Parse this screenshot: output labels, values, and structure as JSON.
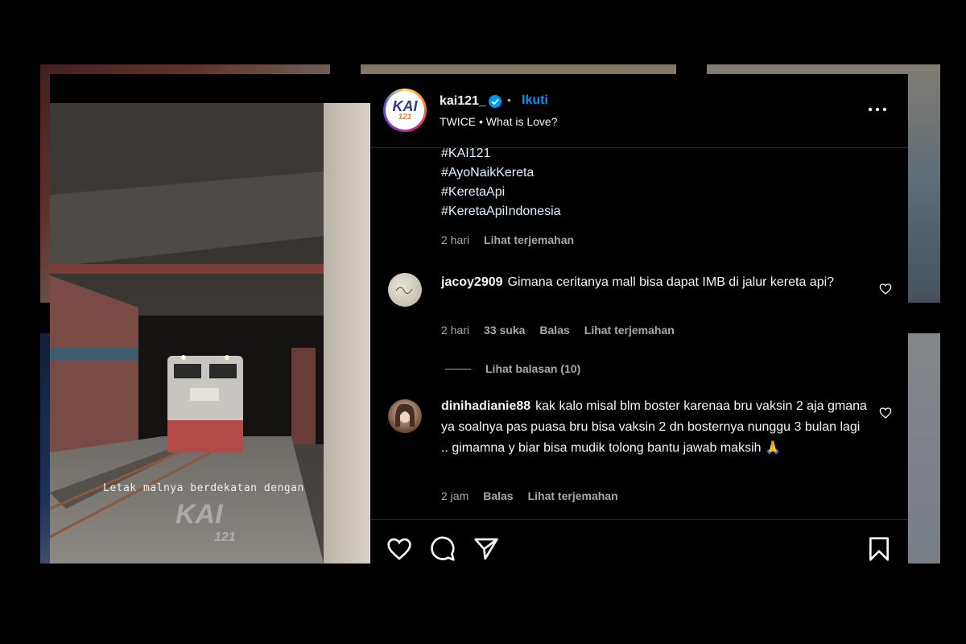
{
  "post": {
    "username": "kai121_",
    "follow_label": "Ikuti",
    "separator": "•",
    "music": "TWICE • What is Love?",
    "avatar_logo": "KAI",
    "avatar_logo_sub": "121"
  },
  "video": {
    "caption_overlay": "Letak malnya berdekatan dengan",
    "watermark": "KAI",
    "watermark_sub": "121"
  },
  "caption": {
    "hashtags": [
      "#KAI121",
      "#AyoNaikKereta",
      "#KeretaApi",
      "#KeretaApiIndonesia"
    ],
    "time": "2 hari",
    "translate": "Lihat terjemahan"
  },
  "comments": [
    {
      "username": "jacoy2909",
      "text": "Gimana ceritanya mall bisa dapat IMB di jalur kereta api?",
      "time": "2 hari",
      "likes": "33 suka",
      "reply": "Balas",
      "translate": "Lihat terjemahan",
      "view_replies": "Lihat balasan (10)"
    },
    {
      "username": "dinihadianie88",
      "text": "kak kalo misal blm boster karenaa bru vaksin 2 aja gmana ya soalnya pas puasa bru bisa vaksin 2 dn bosternya nunggu 3 bulan lagi .. gimamna y biar bisa mudik tolong bantu jawab maksih 🙏",
      "time": "2 jam",
      "reply": "Balas",
      "translate": "Lihat terjemahan"
    }
  ],
  "icons": {
    "verified": "verified-badge-icon",
    "more": "more-options-icon",
    "like": "heart-icon",
    "comment": "comment-icon",
    "share": "share-icon",
    "save": "bookmark-icon"
  },
  "colors": {
    "accent": "#0095f6",
    "background": "#000000",
    "text": "#f5f5f5",
    "muted": "#a8a8a8"
  }
}
